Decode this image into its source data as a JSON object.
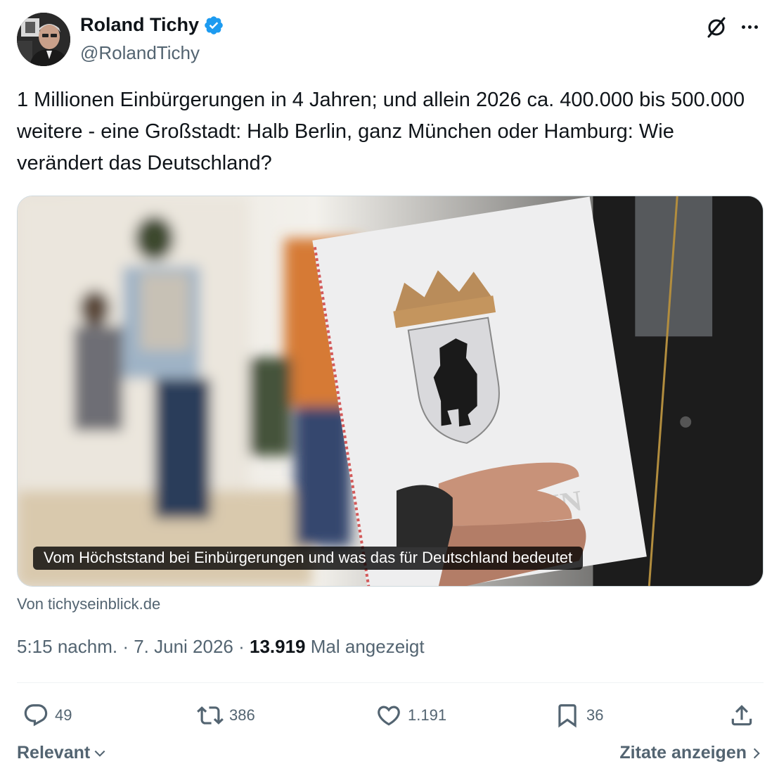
{
  "author": {
    "name": "Roland Tichy",
    "handle": "@RolandTichy"
  },
  "icons": {
    "verified": "verified-badge-icon",
    "grok": "grok-icon",
    "more": "more-options-icon",
    "reply": "reply-icon",
    "retweet": "retweet-icon",
    "like": "like-icon",
    "bookmark": "bookmark-icon",
    "share": "share-icon"
  },
  "colors": {
    "verified": "#1d9bf0",
    "text": "#0f1419",
    "secondary": "#536471"
  },
  "tweet": {
    "text": "1 Millionen Einbürgerungen in 4 Jahren; und allein 2026 ca. 400.000 bis 500.000 weitere - eine Großstadt: Halb Berlin, ganz München oder Hamburg: Wie verändert das Deutschland?"
  },
  "card": {
    "caption": "Vom Höchststand bei Einbürgerungen und was das für Deutschland bedeutet",
    "folder_text": "BERLIN",
    "source": "Von tichyseinblick.de"
  },
  "meta": {
    "time": "5:15 nachm.",
    "separator": " · ",
    "date": "7. Juni 2026",
    "views_count": "13.919",
    "views_label": " Mal angezeigt"
  },
  "actions": {
    "replies": "49",
    "retweets": "386",
    "likes": "1.191",
    "bookmarks": "36"
  },
  "footer": {
    "sort_label": "Relevant",
    "quotes_label": "Zitate anzeigen"
  }
}
